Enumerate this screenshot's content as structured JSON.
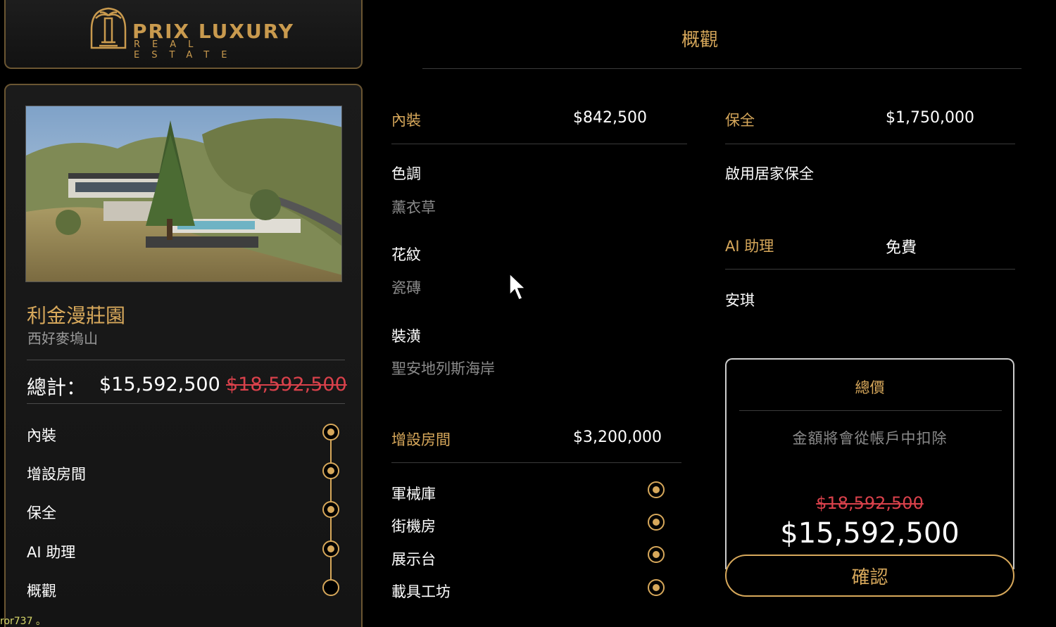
{
  "brand": {
    "name": "PRIX LUXURY",
    "subtitle": "REAL ESTATE"
  },
  "property": {
    "name": "利金漫莊園",
    "location": "西好麥塢山",
    "total_label": "總計：",
    "total_price": "$15,592,500",
    "original_price": "$18,592,500"
  },
  "steps": [
    {
      "label": "內裝",
      "done": true
    },
    {
      "label": "增設房間",
      "done": true
    },
    {
      "label": "保全",
      "done": true
    },
    {
      "label": "AI 助理",
      "done": true
    },
    {
      "label": "概觀",
      "done": false
    }
  ],
  "overview": {
    "title": "概觀",
    "interior": {
      "label": "內裝",
      "price": "$842,500",
      "options": [
        {
          "label": "色調",
          "value": "薰衣草"
        },
        {
          "label": "花紋",
          "value": "瓷磚"
        },
        {
          "label": "裝潢",
          "value": "聖安地列斯海岸"
        }
      ]
    },
    "rooms": {
      "label": "增設房間",
      "price": "$3,200,000",
      "items": [
        "軍械庫",
        "街機房",
        "展示台",
        "載具工坊"
      ]
    },
    "security": {
      "label": "保全",
      "price": "$1,750,000",
      "option": "啟用居家保全"
    },
    "assistant": {
      "label": "AI 助理",
      "price": "免費",
      "option": "安琪"
    },
    "total": {
      "title": "總價",
      "note": "金額將會從帳戶中扣除",
      "original_price": "$18,592,500",
      "price": "$15,592,500"
    },
    "confirm_label": "確認"
  },
  "footer_text": "ror737 。",
  "colors": {
    "accent": "#d7a85b",
    "discount": "#d9414b",
    "background": "#000000"
  }
}
